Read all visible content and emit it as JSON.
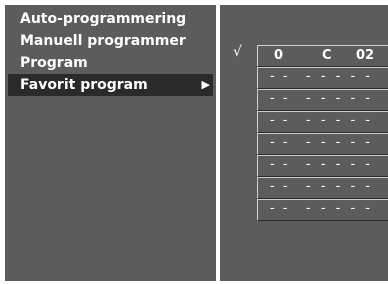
{
  "menu": {
    "items": [
      {
        "label": "Auto-programmering"
      },
      {
        "label": "Manuell programmer"
      },
      {
        "label": "Program"
      },
      {
        "label": "Favorit program",
        "arrow": "▶"
      }
    ]
  },
  "favorites": {
    "checkmark": "√",
    "rows": [
      {
        "number": "0",
        "col2": "C",
        "col3": "02"
      },
      {
        "number": "- -",
        "name": "- - - - -"
      },
      {
        "number": "- -",
        "name": "- - - - -"
      },
      {
        "number": "- -",
        "name": "- - - - -"
      },
      {
        "number": "- -",
        "name": "- - - - -"
      },
      {
        "number": "- -",
        "name": "- - - - -"
      },
      {
        "number": "- -",
        "name": "- - - - -"
      },
      {
        "number": "- -",
        "name": "- - - - -"
      }
    ]
  },
  "icons": {
    "submenu_arrow": "play-right-icon",
    "check": "checkmark-icon"
  },
  "colors": {
    "panel": "#5c5c5c",
    "selected": "#2a2a2a",
    "text": "#ffffff",
    "background": "#ffffff"
  }
}
